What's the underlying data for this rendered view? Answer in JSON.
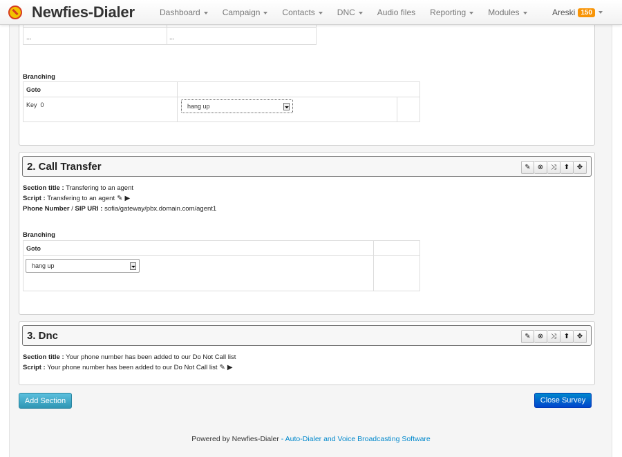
{
  "navbar": {
    "brand": "Newfies-Dialer",
    "items": [
      {
        "label": "Dashboard",
        "dropdown": true
      },
      {
        "label": "Campaign",
        "dropdown": true
      },
      {
        "label": "Contacts",
        "dropdown": true
      },
      {
        "label": "DNC",
        "dropdown": true
      },
      {
        "label": "Audio files",
        "dropdown": false
      },
      {
        "label": "Reporting",
        "dropdown": true
      },
      {
        "label": "Modules",
        "dropdown": true
      }
    ],
    "user": "Areski",
    "badge": "150"
  },
  "section1": {
    "partial_cells": [
      "...",
      "..."
    ],
    "branching_label": "Branching",
    "goto_header": "Goto",
    "key_label": "Key",
    "key_value": "0",
    "select_value": "hang up"
  },
  "section2": {
    "title": "2. Call Transfer",
    "section_title_label": "Section title :",
    "section_title_value": "Transfering to an agent",
    "script_label": "Script :",
    "script_value": "Transfering to an agent",
    "phone_label": "Phone Number",
    "sip_label": "SIP URI :",
    "phone_value": "sofia/gateway/pbx.domain.com/agent1",
    "branching_label": "Branching",
    "goto_header": "Goto",
    "select_value": "hang up"
  },
  "section3": {
    "title": "3. Dnc",
    "section_title_label": "Section title :",
    "section_title_value": "Your phone number has been added to our Do Not Call list",
    "script_label": "Script :",
    "script_value": "Your phone number has been added to our Do Not Call list"
  },
  "actions": {
    "add_section": "Add Section",
    "close_survey": "Close Survey"
  },
  "footer": {
    "prefix": "Powered by Newfies-Dialer",
    "separator": "-",
    "link": "Auto-Dialer and Voice Broadcasting Software"
  },
  "icons": [
    "edit-icon",
    "delete-icon",
    "shuffle-icon",
    "move-up-icon",
    "move-icon"
  ]
}
